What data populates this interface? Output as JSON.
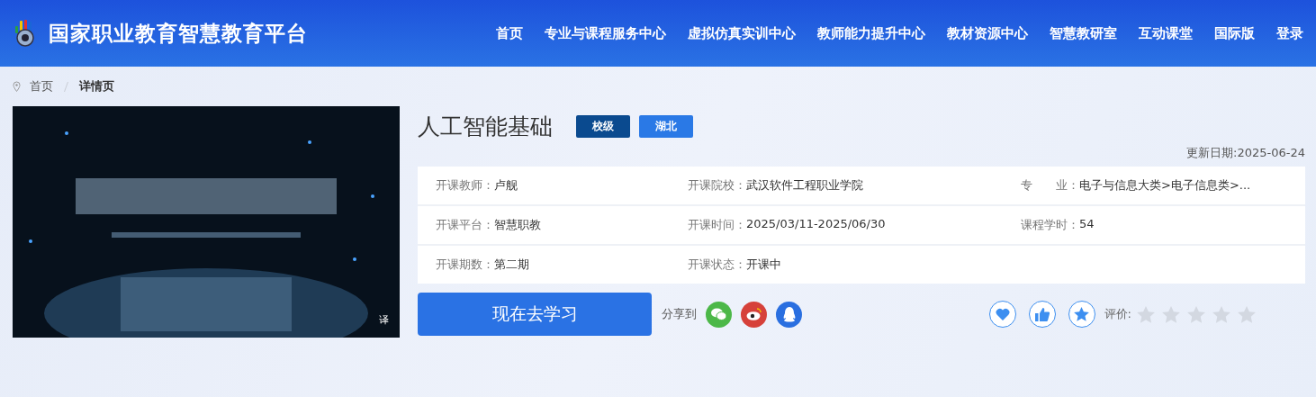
{
  "header": {
    "site_title": "国家职业教育智慧教育平台",
    "nav": [
      {
        "label": "首页"
      },
      {
        "label": "专业与课程服务中心"
      },
      {
        "label": "虚拟仿真实训中心"
      },
      {
        "label": "教师能力提升中心"
      },
      {
        "label": "教材资源中心"
      },
      {
        "label": "智慧教研室"
      },
      {
        "label": "互动课堂"
      },
      {
        "label": "国际版"
      },
      {
        "label": "登录"
      }
    ]
  },
  "breadcrumb": [
    {
      "label": "首页",
      "selected": false
    },
    {
      "label": "详情页",
      "selected": true
    }
  ],
  "cover": {
    "kind": "picture",
    "badge": "译"
  },
  "course": {
    "title": "人工智能基础",
    "tags": [
      {
        "label": "校级",
        "color": "#0a4a8f"
      },
      {
        "label": "湖北",
        "color": "#2a79e6"
      }
    ],
    "updated": "更新日期:2025-06-24"
  },
  "info_rows": [
    [
      {
        "label": "开课教师：",
        "value": "卢舰"
      },
      {
        "label": "开课院校：",
        "value": "武汉软件工程职业学院"
      },
      {
        "label": "专　　业：",
        "value": "电子与信息大类>电子信息类>..."
      }
    ],
    [
      {
        "label": "开课平台：",
        "value": "智慧职教"
      },
      {
        "label": "开课时间：",
        "value": "2025/03/11-2025/06/30"
      },
      {
        "label": "课程学时：",
        "value": "54"
      }
    ],
    [
      {
        "label": "开课期数：",
        "value": "第二期"
      },
      {
        "label": "开课状态：",
        "value": "开课中"
      }
    ]
  ],
  "study_button": "现在去学习",
  "share": {
    "label": "分享到",
    "targets": [
      {
        "kind": "wechat",
        "color": "#4cb848"
      },
      {
        "kind": "weibo",
        "color": "#d6413a"
      },
      {
        "kind": "qq",
        "color": "#2a6fe0"
      }
    ]
  },
  "actions": [
    {
      "kind": "favorite"
    },
    {
      "kind": "like"
    },
    {
      "kind": "star"
    }
  ],
  "rating": {
    "label": "评价:",
    "stars": 0
  }
}
